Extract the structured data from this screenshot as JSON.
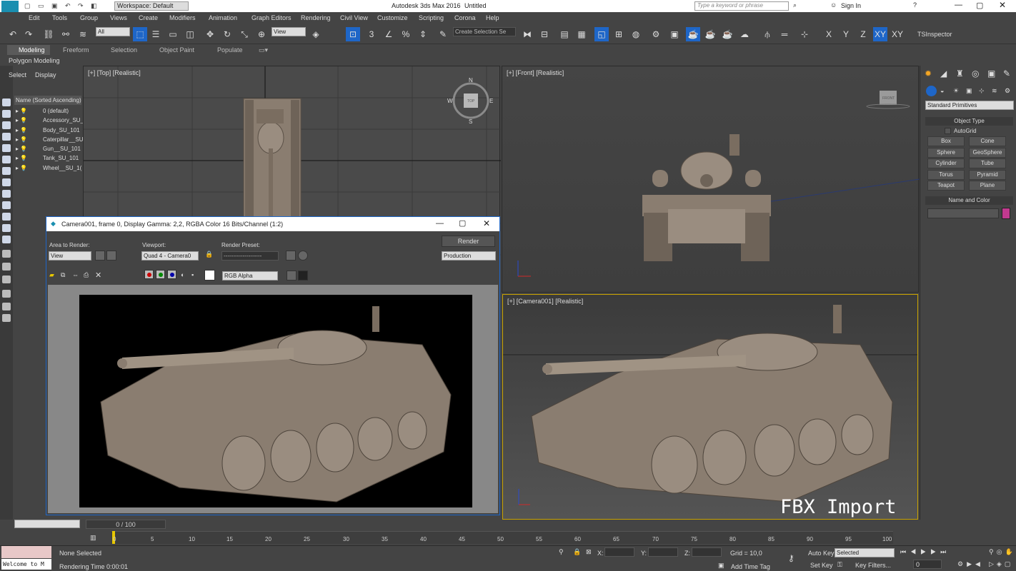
{
  "app": {
    "title": "Autodesk 3ds Max 2016",
    "doc": "Untitled",
    "workspace": "Workspace: Default",
    "search_placeholder": "Type a keyword or phrase",
    "signin": "Sign In",
    "logo": "MAX"
  },
  "menu": [
    "Edit",
    "Tools",
    "Group",
    "Views",
    "Create",
    "Modifiers",
    "Animation",
    "Graph Editors",
    "Rendering",
    "Civil View",
    "Customize",
    "Scripting",
    "Corona",
    "Help"
  ],
  "toolbar": {
    "filter": "All",
    "refcoord": "View",
    "selset": "Create Selection Se",
    "snaps": "3",
    "axes": [
      "X",
      "Y",
      "Z",
      "XY",
      "XY"
    ],
    "tsinspector": "TSInspector"
  },
  "ribbon": {
    "tabs": [
      "Modeling",
      "Freeform",
      "Selection",
      "Object Paint",
      "Populate"
    ],
    "sub": "Polygon Modeling"
  },
  "scene": {
    "tabs": [
      "Select",
      "Display"
    ],
    "header": "Name (Sorted Ascending)",
    "items": [
      "0 (default)",
      "Accessory_SU_",
      "Body_SU_101",
      "Caterpillar__SU",
      "Gun__SU_101",
      "Tank_SU_101",
      "Wheel__SU_1("
    ]
  },
  "viewports": {
    "top": "[+] [Top] [Realistic]",
    "front": "[+] [Front] [Realistic]",
    "camera": "[+] [Camera001] [Realistic]",
    "watermark": "FBX Import",
    "cube_top": "TOP",
    "cube_front": "FRONT",
    "compass": [
      "N",
      "W",
      "E",
      "S"
    ]
  },
  "render": {
    "title": "Camera001, frame 0, Display Gamma: 2,2, RGBA Color 16 Bits/Channel (1:2)",
    "area_label": "Area to Render:",
    "area_value": "View",
    "viewport_label": "Viewport:",
    "viewport_value": "Quad 4 - Camera0",
    "preset_label": "Render Preset:",
    "preset_value": "--------------------",
    "render_btn": "Render",
    "production": "Production",
    "channel": "RGB Alpha"
  },
  "cmdpanel": {
    "dropdown": "Standard Primitives",
    "object_type": "Object Type",
    "autogrid": "AutoGrid",
    "buttons": [
      "Box",
      "Cone",
      "Sphere",
      "GeoSphere",
      "Cylinder",
      "Tube",
      "Torus",
      "Pyramid",
      "Teapot",
      "Plane"
    ],
    "name_color": "Name and Color",
    "swatch": "#c2398f"
  },
  "timeline": {
    "frame": "0 / 100",
    "ticks": [
      "0",
      "5",
      "10",
      "15",
      "20",
      "25",
      "30",
      "35",
      "40",
      "45",
      "50",
      "55",
      "60",
      "65",
      "70",
      "75",
      "80",
      "85",
      "90",
      "95",
      "100"
    ]
  },
  "status": {
    "welcome": "Welcome to M",
    "selected": "None Selected",
    "render_time": "Rendering Time  0:00:01",
    "x": "X:",
    "y": "Y:",
    "z": "Z:",
    "grid": "Grid = 10,0",
    "add_tag": "Add Time Tag",
    "autokey": "Auto Key",
    "setkey": "Set Key",
    "key_mode": "Selected",
    "key_filters": "Key Filters...",
    "frame_field": "0"
  },
  "colors": {
    "accent": "#1e66c8",
    "camera_border": "#c9a300",
    "tank": "#8a7d70"
  }
}
